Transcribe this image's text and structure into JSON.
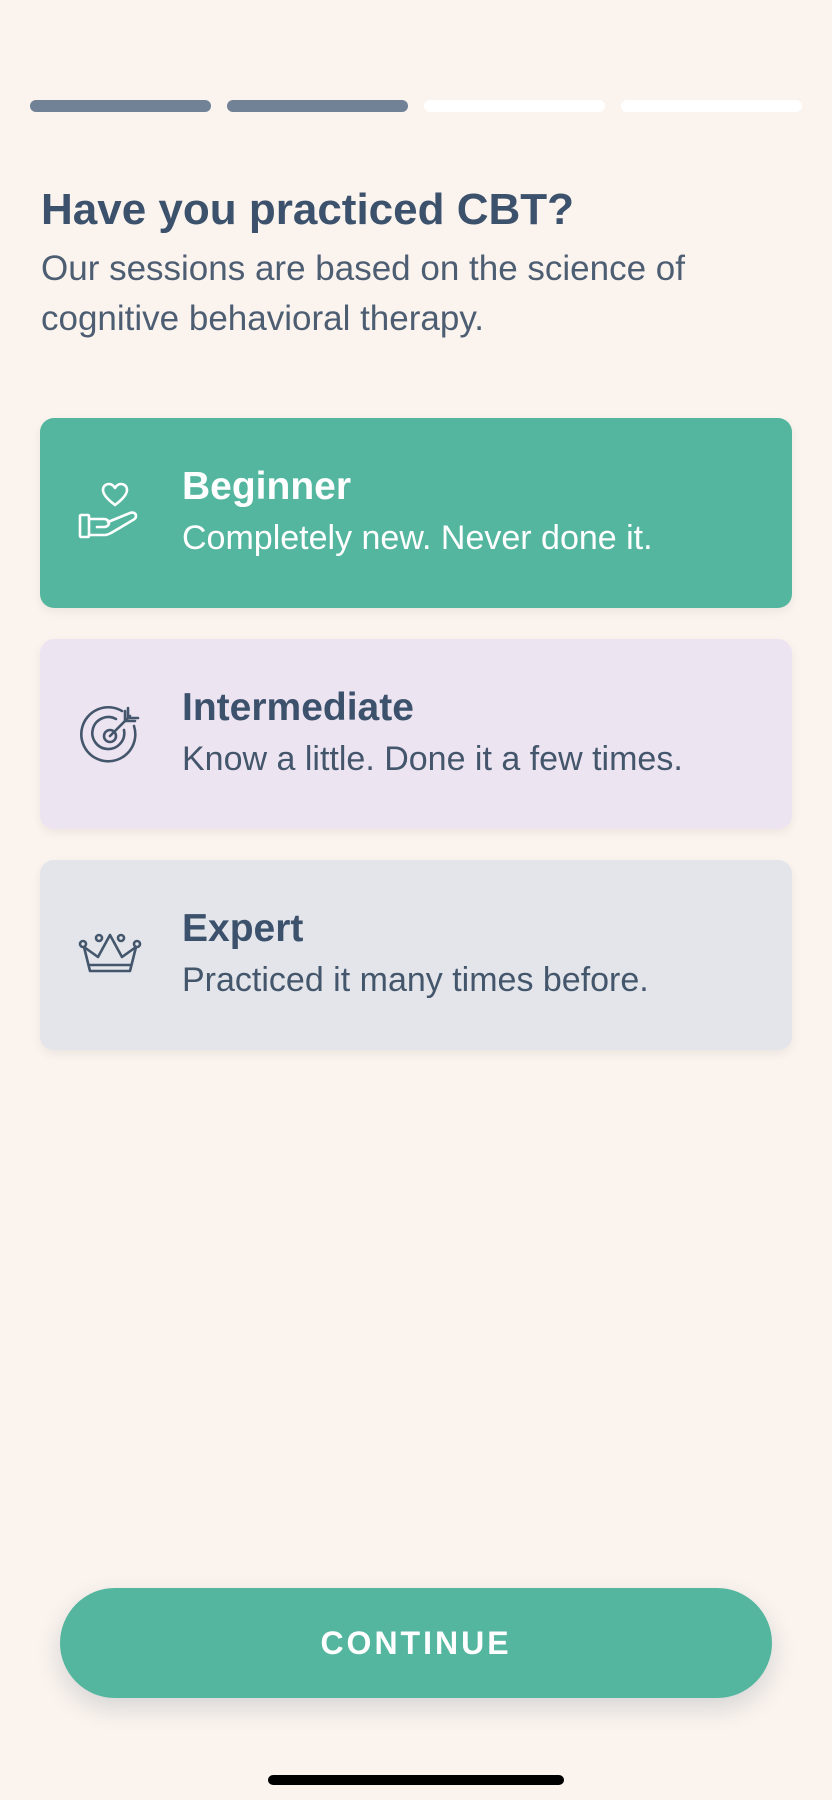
{
  "progress": {
    "current_step": 2,
    "total_steps": 4
  },
  "header": {
    "title": "Have you practiced CBT?",
    "subtitle": "Our sessions are based on the science of cognitive behavioral therapy."
  },
  "options": [
    {
      "label": "Beginner",
      "description": "Completely new. Never done it.",
      "icon": "hand-heart-icon",
      "selected": true
    },
    {
      "label": "Intermediate",
      "description": "Know a little. Done it a few times.",
      "icon": "target-icon",
      "selected": false
    },
    {
      "label": "Expert",
      "description": "Practiced it many times before.",
      "icon": "crown-icon",
      "selected": false
    }
  ],
  "continue_button": {
    "label": "CONTINUE"
  },
  "colors": {
    "accent": "#55B6A0",
    "text_primary": "#3C516B",
    "background": "#FAF3EE",
    "intermediate_bg": "#EDE4F1",
    "expert_bg": "#E3E5EA",
    "progress_done": "#718196",
    "progress_todo": "#FFFFFF"
  }
}
